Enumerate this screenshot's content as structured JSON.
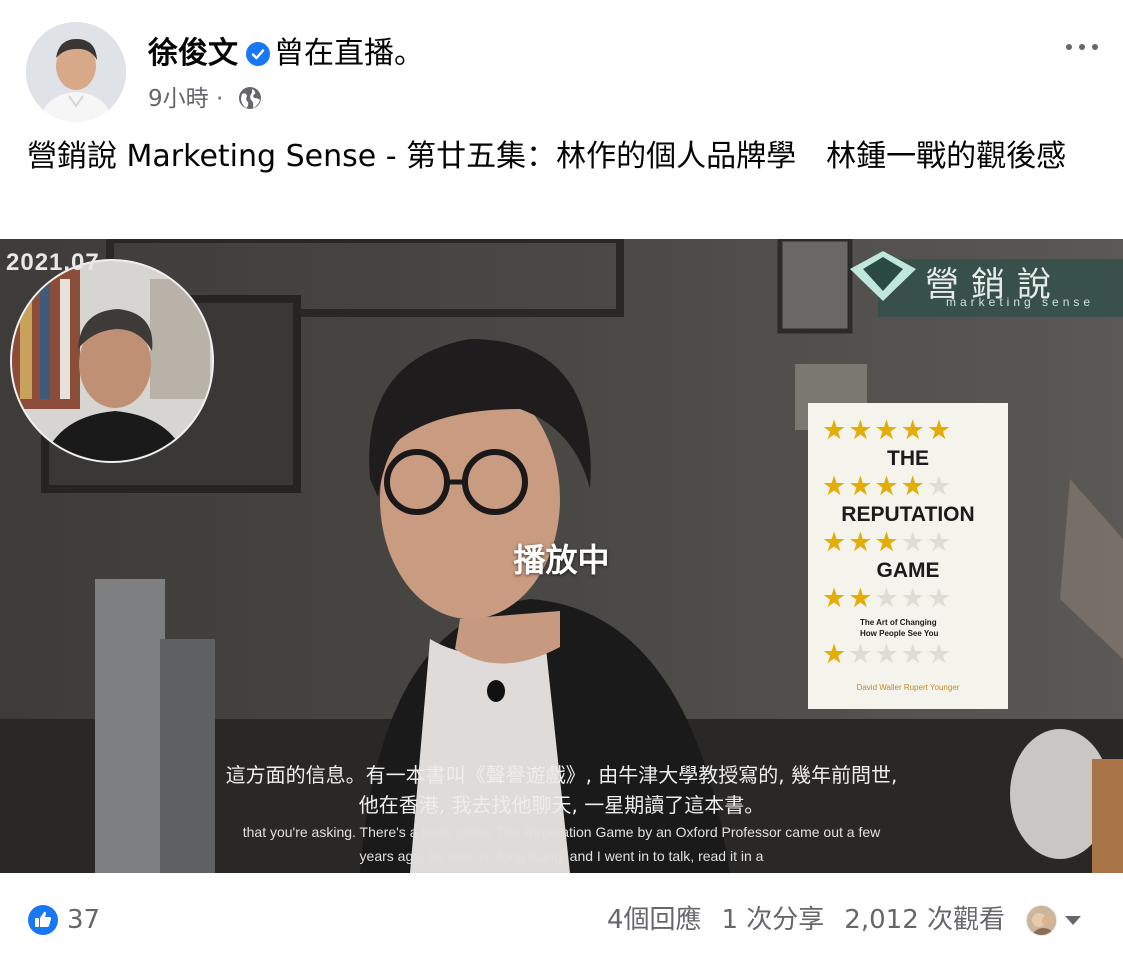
{
  "post": {
    "author": "徐俊文",
    "action": "曾在直播。",
    "time": "9小時",
    "separator": "·",
    "caption": "營銷說 Marketing Sense - 第廿五集：林作的個人品牌學　林鍾一戰的觀後感"
  },
  "video": {
    "date_stamp": "2021.07",
    "status": "播放中",
    "brand_title": "營銷說",
    "brand_subtitle": "marketing sense",
    "book": {
      "title_line1": "THE",
      "title_line2": "REPUTATION",
      "title_line3": "GAME",
      "subtitle_line1": "The Art of Changing",
      "subtitle_line2": "How People See You",
      "authors": "David Waller   Rupert Younger",
      "star_rows": [
        5,
        4,
        3,
        2,
        1
      ]
    },
    "subtitles_cn": [
      "這方面的信息。有一本書叫《聲譽遊戲》, 由牛津大學教授寫的, 幾年前問世,",
      "他在香港, 我去找他聊天, 一星期讀了這本書。"
    ],
    "subtitles_en": [
      "that you're asking. There's a book called The Reputation Game by an Oxford Professor came out a few",
      "years ago, he was in Hong Kong, and I went in to talk, read it in a"
    ]
  },
  "footer": {
    "like_count": "37",
    "comments": "4個回應",
    "shares": "1 次分享",
    "views": "2,012 次觀看"
  },
  "colors": {
    "accent": "#1877f2",
    "secondary_text": "#65676b",
    "primary_text": "#050505",
    "star": "#e2ad08"
  },
  "icons": [
    "verified-badge-icon",
    "globe-icon",
    "more-options-icon",
    "like-icon",
    "chevron-down-icon"
  ]
}
